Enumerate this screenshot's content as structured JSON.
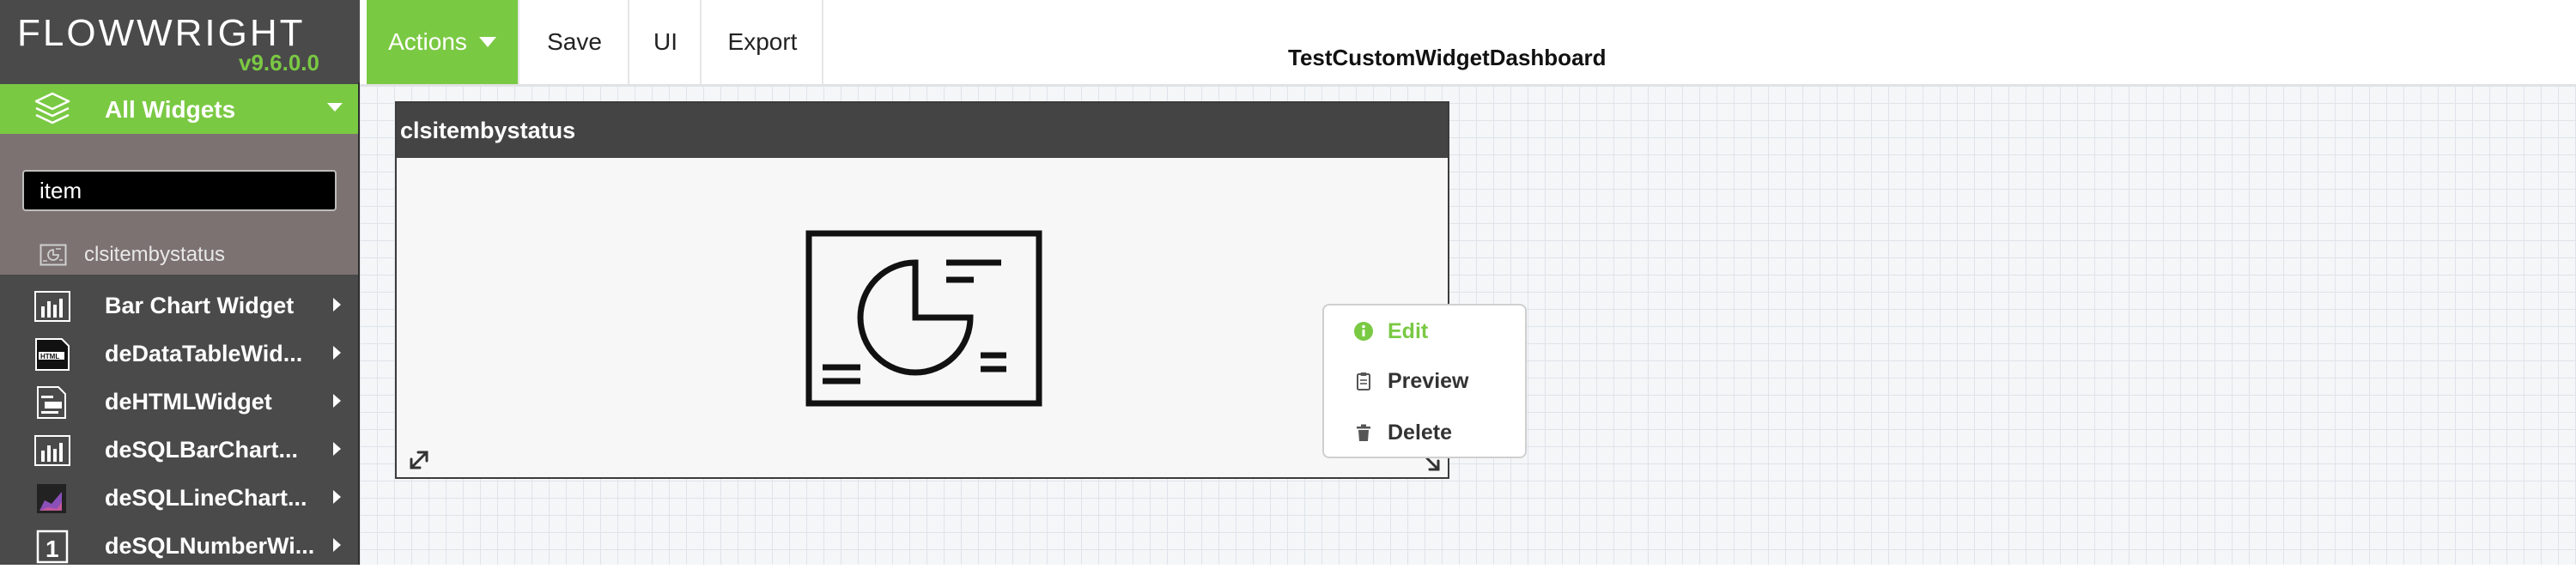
{
  "app": {
    "logo": "FLOWWRIGHT",
    "version": "v9.6.0.0"
  },
  "sidebar": {
    "filter_label": "All Widgets",
    "search": {
      "value": "item",
      "placeholder": ""
    },
    "search_results": [
      {
        "label": "clsitembystatus",
        "icon": "pie-chart-icon"
      }
    ],
    "items": [
      {
        "label": "Bar Chart Widget",
        "icon": "bar-chart-icon"
      },
      {
        "label": "deDataTableWid...",
        "icon": "html-file-icon"
      },
      {
        "label": "deHTMLWidget",
        "icon": "html-doc-icon"
      },
      {
        "label": "deSQLBarChart...",
        "icon": "bar-chart-icon"
      },
      {
        "label": "deSQLLineChart...",
        "icon": "line-chart-icon"
      },
      {
        "label": "deSQLNumberWi...",
        "icon": "number-one-icon"
      }
    ]
  },
  "toolbar": {
    "actions_label": "Actions",
    "save_label": "Save",
    "ui_label": "UI",
    "export_label": "Export"
  },
  "dashboard": {
    "title": "TestCustomWidgetDashboard",
    "widget": {
      "title": "clsitembystatus",
      "icon": "pie-chart-icon"
    }
  },
  "context_menu": {
    "edit_label": "Edit",
    "preview_label": "Preview",
    "delete_label": "Delete"
  },
  "colors": {
    "accent": "#7ac943",
    "sidebar_bg": "#4a4a4a",
    "search_panel_bg": "#7d7272",
    "widget_header_bg": "#444444"
  }
}
